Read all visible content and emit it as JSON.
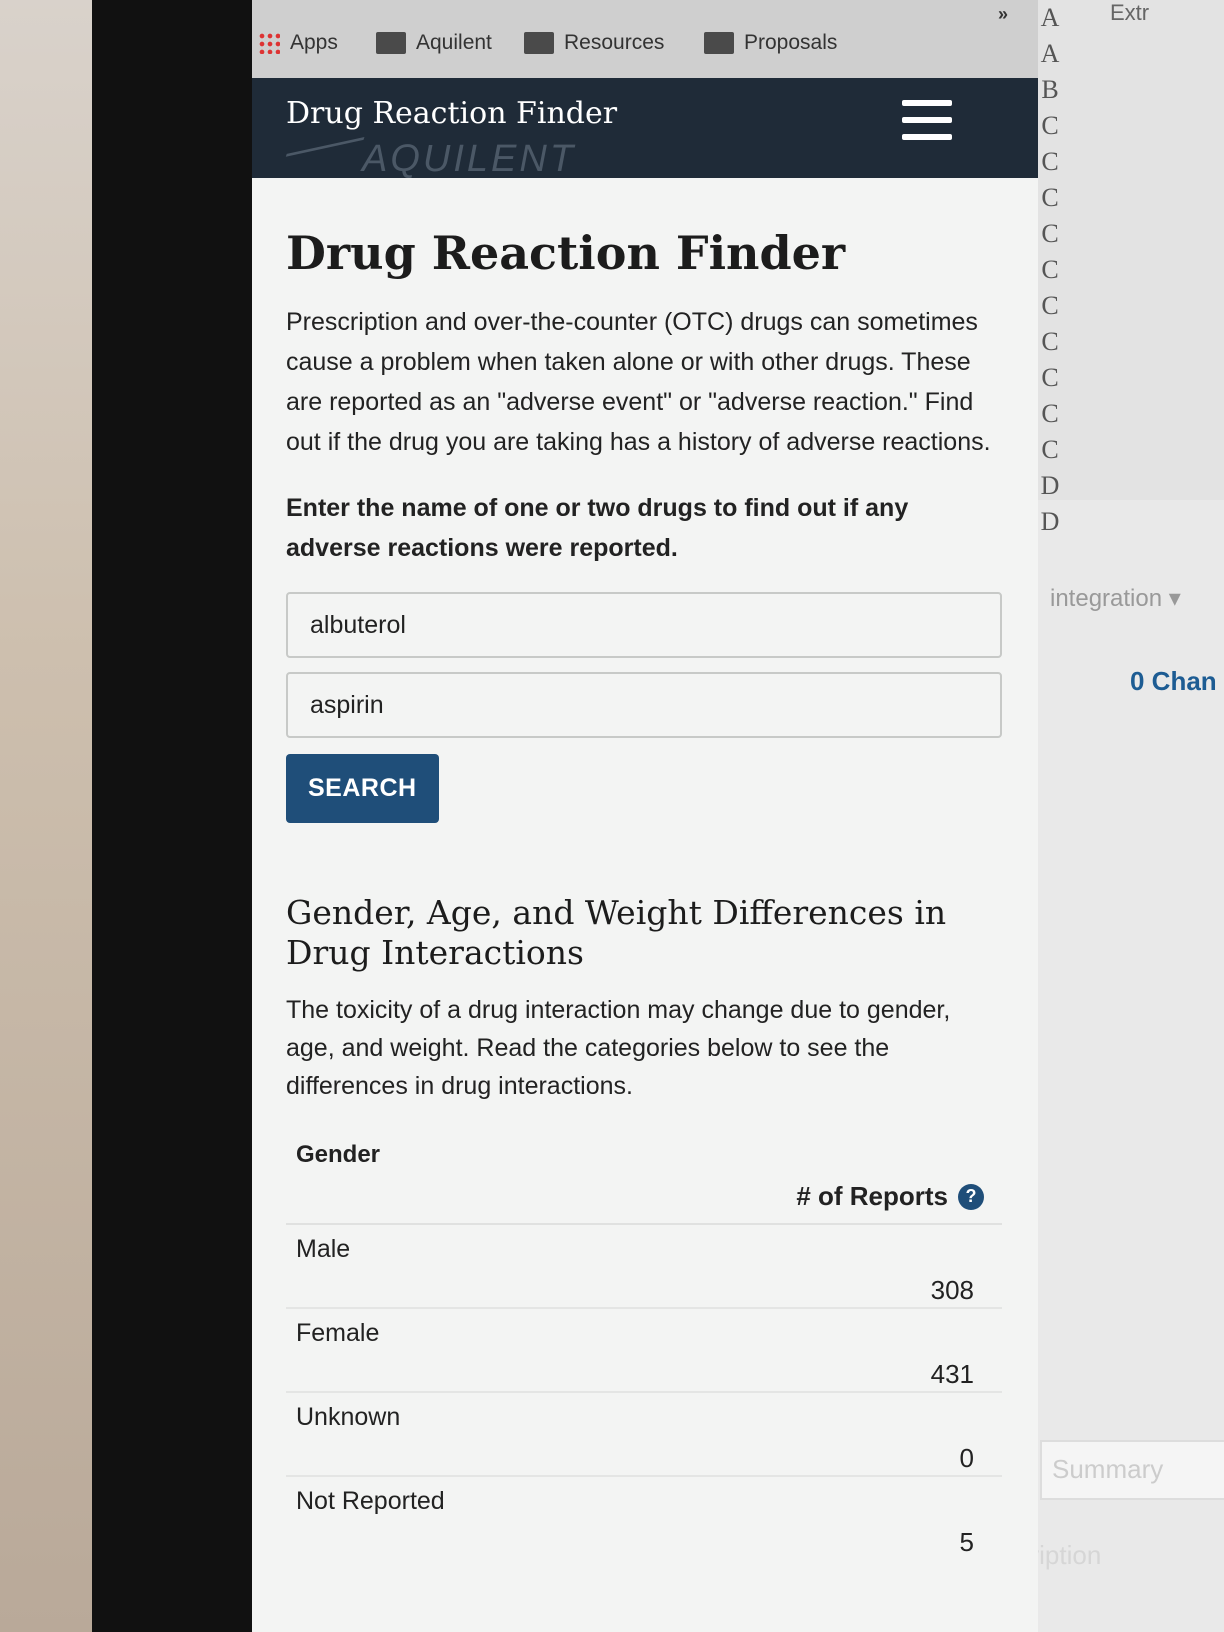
{
  "bookmarks": [
    {
      "label": "Apps",
      "icon": "apps-grid-icon"
    },
    {
      "label": "Aquilent",
      "icon": "folder-icon"
    },
    {
      "label": "Resources",
      "icon": "folder-icon"
    },
    {
      "label": "Proposals",
      "icon": "folder-icon"
    }
  ],
  "bookmarks_overflow": "»",
  "navbar": {
    "title": "Drug Reaction Finder",
    "logo_text": "AQUILENT"
  },
  "page": {
    "heading": "Drug Reaction Finder",
    "intro": "Prescription and over-the-counter (OTC) drugs can sometimes cause a problem when taken alone or with other drugs. These are reported as an \"adverse event\" or \"adverse reaction.\" Find out if the drug you are taking has a history of adverse reactions.",
    "prompt": "Enter the name of one or two drugs to find out if any adverse reactions were reported.",
    "drug1_value": "albuterol",
    "drug2_value": "aspirin",
    "search_label": "SEARCH",
    "section_heading": "Gender, Age, and Weight Differences in Drug Interactions",
    "section_desc": "The toxicity of a drug interaction may change due to gender, age, and weight. Read the categories below to see the differences in drug interactions."
  },
  "gender_table": {
    "header_category": "Gender",
    "header_reports": "# of Reports",
    "help_glyph": "?",
    "rows": [
      {
        "label": "Male",
        "count": "308"
      },
      {
        "label": "Female",
        "count": "431"
      },
      {
        "label": "Unknown",
        "count": "0"
      },
      {
        "label": "Not Reported",
        "count": "5"
      }
    ]
  },
  "background_app": {
    "letters": [
      "A",
      "A",
      "B",
      "C",
      "C",
      "C",
      "C",
      "C",
      "C",
      "C",
      "C",
      "C",
      "C",
      "D",
      "D"
    ],
    "top_tab": "Extr",
    "integration_label": "integration ▾",
    "changes_label": "0 Chan",
    "summary_placeholder": "Summary",
    "description_label": "escription"
  }
}
